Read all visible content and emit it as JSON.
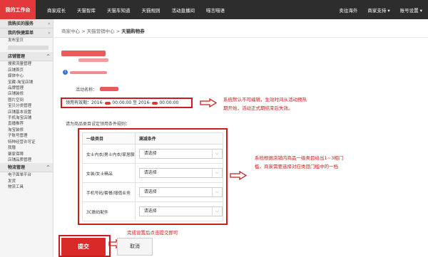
{
  "topbar": {
    "home": "我的工作台",
    "nav": [
      "商家成长",
      "天猫智库",
      "天猫车知道",
      "天猫规则",
      "活动直播间",
      "喵言喵语"
    ],
    "right": [
      "卖往海外",
      "商家支持 ▾",
      "账号设置 ▾"
    ]
  },
  "sidebar": {
    "group1_title": "我购买的服务",
    "group2_title": "我的快捷菜单",
    "group2_items": [
      "发布宝贝"
    ],
    "group3_title": "店铺管理",
    "group3_items": [
      "搜索流量管理",
      "店铺首页",
      "媒体中心",
      "宝藏-淘宝店铺",
      "品牌管理",
      "店铺装修",
      "图片空间",
      "宝贝分类管理",
      "店铺基本设置",
      "手机淘宝店铺",
      "直播推荐",
      "淘宝装修",
      "子账号管理",
      "特种经营许可证",
      "我赠",
      "聚家保障",
      "店铺品质管理"
    ],
    "group4_title": "物流管理",
    "group4_items": [
      "电子面单平台",
      "发货",
      "物流工具"
    ]
  },
  "breadcrumb": {
    "a": "商家中心",
    "b": "天猫营销中心",
    "current": "天猫购物券",
    "sep": ">"
  },
  "form": {
    "activity_name_label": "活动名称：",
    "validity_text_1": "领用有效期：2016-",
    "validity_text_2": "00:00:00 至 2016-",
    "validity_text_3": "00:00:00",
    "category_prompt": "请为商品类目设定领用条件规则：",
    "table_headers": [
      "一级类目",
      "满减条件"
    ],
    "rows": [
      {
        "category": "女士内衣/男士内衣/家居服",
        "condition": "请选择"
      },
      {
        "category": "女装/女士精品",
        "condition": "请选择"
      },
      {
        "category": "手机号码/套餐/增值业务",
        "condition": "请选择"
      },
      {
        "category": "3C数码配件",
        "condition": "请选择"
      }
    ]
  },
  "notes": {
    "n1_line1": "系统默认不可编辑，生效时间从活动预热",
    "n1_line2": "期开始，活动正式期结束后失效。",
    "n2_line1": "系统根据店铺内商品一级类目给出1~3相门",
    "n2_line2": "槛，商家需要选择对应类目门槛中的一档",
    "n3": "完成设置后点击提交即可"
  },
  "buttons": {
    "submit": "提交",
    "cancel": "取消"
  },
  "icons": {
    "info": "info-icon",
    "chevron": "chevron-down-icon",
    "arrow": "arrow-right-icon"
  },
  "colors": {
    "accent": "#d92a2a",
    "topbar": "#2d2d2d",
    "annotation": "#c81e1e"
  }
}
